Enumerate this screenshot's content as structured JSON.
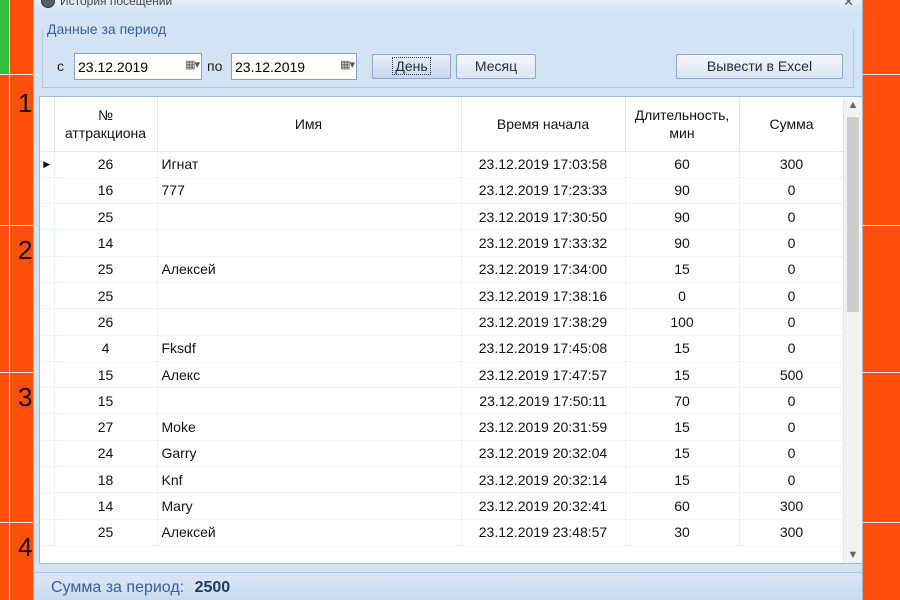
{
  "background": {
    "numbers": [
      "1",
      "2",
      "3",
      "4"
    ]
  },
  "window": {
    "title": "История посещений"
  },
  "filter": {
    "group_title": "Данные за период",
    "from_label": "с",
    "from_value": "23.12.2019",
    "to_label": "по",
    "to_value": "23.12.2019",
    "day_button": "День",
    "month_button": "Месяц",
    "export_button": "Вывести в Excel"
  },
  "grid": {
    "columns": {
      "num_line1": "№",
      "num_line2": "аттракциона",
      "name": "Имя",
      "start": "Время начала",
      "duration_line1": "Длительность,",
      "duration_line2": "мин",
      "sum": "Сумма"
    },
    "rows": [
      {
        "num": "26",
        "name": "Игнат",
        "start": "23.12.2019 17:03:58",
        "duration": "60",
        "sum": "300"
      },
      {
        "num": "16",
        "name": "777",
        "start": "23.12.2019 17:23:33",
        "duration": "90",
        "sum": "0"
      },
      {
        "num": "25",
        "name": "",
        "start": "23.12.2019 17:30:50",
        "duration": "90",
        "sum": "0"
      },
      {
        "num": "14",
        "name": "",
        "start": "23.12.2019 17:33:32",
        "duration": "90",
        "sum": "0"
      },
      {
        "num": "25",
        "name": "Алексей",
        "start": "23.12.2019 17:34:00",
        "duration": "15",
        "sum": "0"
      },
      {
        "num": "25",
        "name": "",
        "start": "23.12.2019 17:38:16",
        "duration": "0",
        "sum": "0"
      },
      {
        "num": "26",
        "name": "",
        "start": "23.12.2019 17:38:29",
        "duration": "100",
        "sum": "0"
      },
      {
        "num": "4",
        "name": "Fksdf",
        "start": "23.12.2019 17:45:08",
        "duration": "15",
        "sum": "0"
      },
      {
        "num": "15",
        "name": "Алекс",
        "start": "23.12.2019 17:47:57",
        "duration": "15",
        "sum": "500"
      },
      {
        "num": "15",
        "name": "",
        "start": "23.12.2019 17:50:11",
        "duration": "70",
        "sum": "0"
      },
      {
        "num": "27",
        "name": "Moke",
        "start": "23.12.2019 20:31:59",
        "duration": "15",
        "sum": "0"
      },
      {
        "num": "24",
        "name": "Garry",
        "start": "23.12.2019 20:32:04",
        "duration": "15",
        "sum": "0"
      },
      {
        "num": "18",
        "name": "Knf",
        "start": "23.12.2019 20:32:14",
        "duration": "15",
        "sum": "0"
      },
      {
        "num": "14",
        "name": "Mary",
        "start": "23.12.2019 20:32:41",
        "duration": "60",
        "sum": "300"
      },
      {
        "num": "25",
        "name": "Алексей",
        "start": "23.12.2019 23:48:57",
        "duration": "30",
        "sum": "300"
      }
    ]
  },
  "footer": {
    "label": "Сумма за период:",
    "value": "2500"
  }
}
